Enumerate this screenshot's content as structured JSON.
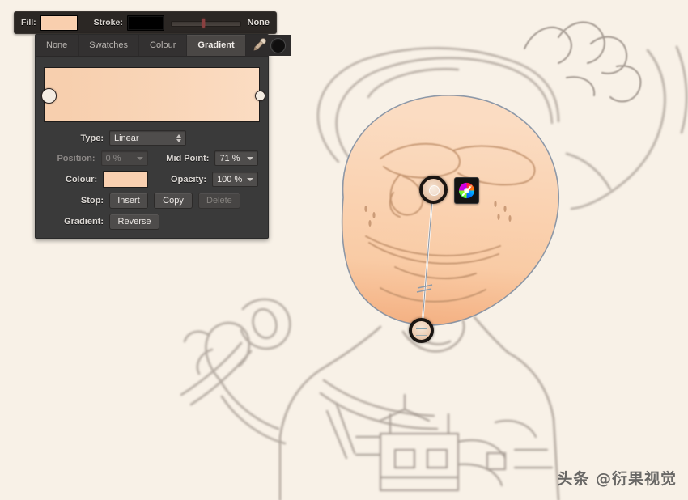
{
  "app": {
    "canvas_background": "#f8f1e7"
  },
  "fill_stroke_bar": {
    "fill_label": "Fill:",
    "fill_colour": "#f9cfae",
    "stroke_label": "Stroke:",
    "stroke_colour": "#000000",
    "stroke_width_value": 45,
    "stroke_none_label": "None"
  },
  "gradient_panel": {
    "tabs": [
      {
        "label": "None",
        "active": false
      },
      {
        "label": "Swatches",
        "active": false
      },
      {
        "label": "Colour",
        "active": false
      },
      {
        "label": "Gradient",
        "active": true
      }
    ],
    "tools": {
      "eyedropper_icon": "eyedropper-icon",
      "dark_swatch_colour": "#100f0f"
    },
    "gradient_preview": {
      "start_colour": "#f7cfae",
      "end_colour": "#fbdcc2",
      "mid_point_percent": 71
    },
    "type": {
      "label": "Type:",
      "value": "Linear"
    },
    "position": {
      "label": "Position:",
      "value": "0 %",
      "disabled": true
    },
    "mid_point": {
      "label": "Mid Point:",
      "value": "71 %"
    },
    "colour": {
      "label": "Colour:",
      "value": "#f9d0b0"
    },
    "opacity": {
      "label": "Opacity:",
      "value": "100 %"
    },
    "stop": {
      "label": "Stop:",
      "insert_label": "Insert",
      "copy_label": "Copy",
      "delete_label": "Delete"
    },
    "gradient": {
      "label": "Gradient:",
      "reverse_label": "Reverse"
    }
  },
  "canvas_widgets": {
    "start_handle": "gradient-start-handle",
    "end_handle": "gradient-end-handle",
    "colour_wheel_button": "colour-wheel-icon"
  },
  "watermark": {
    "text": "头条 @衍果视觉"
  }
}
